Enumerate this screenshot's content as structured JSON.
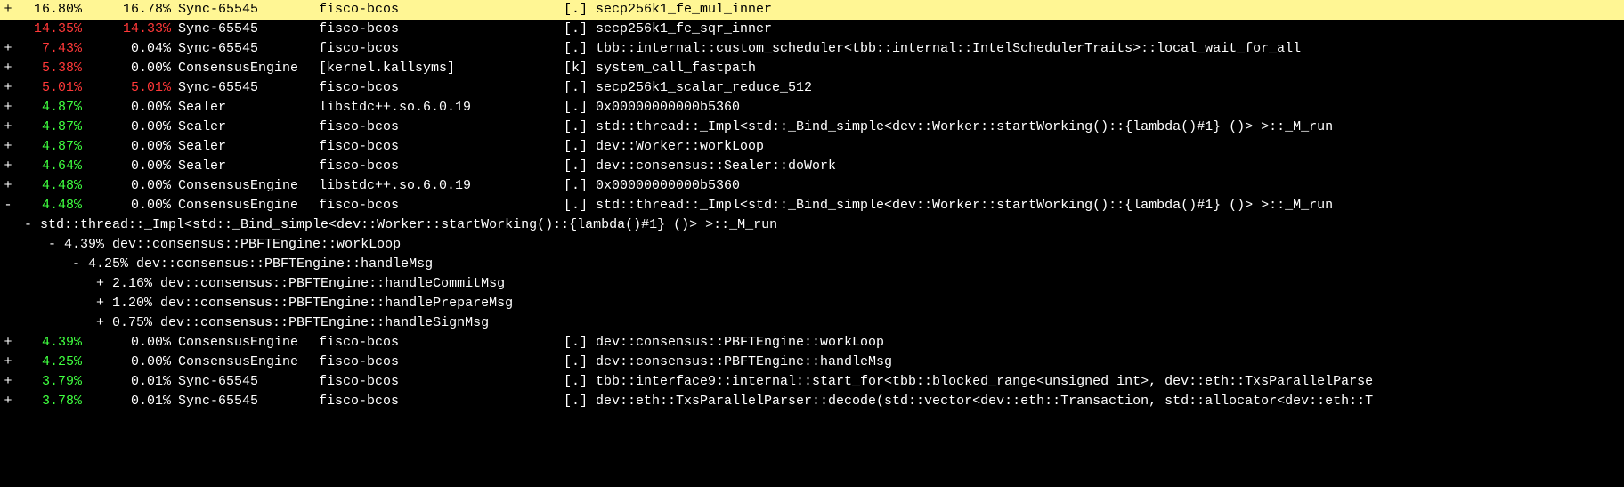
{
  "rows": [
    {
      "expander": "+",
      "overhead": "16.80%",
      "overheadColor": "white",
      "self": "16.78%",
      "selfColor": "white",
      "command": "Sync-65545",
      "object": "fisco-bcos",
      "marker": "[.]",
      "symbol": "secp256k1_fe_mul_inner",
      "highlighted": true
    },
    {
      "expander": "",
      "overhead": "14.35%",
      "overheadColor": "red",
      "self": "14.33%",
      "selfColor": "red",
      "command": "Sync-65545",
      "object": "fisco-bcos",
      "marker": "[.]",
      "symbol": "secp256k1_fe_sqr_inner"
    },
    {
      "expander": "+",
      "overhead": "7.43%",
      "overheadColor": "red",
      "self": "0.04%",
      "selfColor": "white",
      "command": "Sync-65545",
      "object": "fisco-bcos",
      "marker": "[.]",
      "symbol": "tbb::internal::custom_scheduler<tbb::internal::IntelSchedulerTraits>::local_wait_for_all"
    },
    {
      "expander": "+",
      "overhead": "5.38%",
      "overheadColor": "red",
      "self": "0.00%",
      "selfColor": "white",
      "command": "ConsensusEngine",
      "object": "[kernel.kallsyms]",
      "marker": "[k]",
      "symbol": "system_call_fastpath"
    },
    {
      "expander": "+",
      "overhead": "5.01%",
      "overheadColor": "red",
      "self": "5.01%",
      "selfColor": "red",
      "command": "Sync-65545",
      "object": "fisco-bcos",
      "marker": "[.]",
      "symbol": "secp256k1_scalar_reduce_512"
    },
    {
      "expander": "+",
      "overhead": "4.87%",
      "overheadColor": "green",
      "self": "0.00%",
      "selfColor": "white",
      "command": "Sealer",
      "object": "libstdc++.so.6.0.19",
      "marker": "[.]",
      "symbol": "0x00000000000b5360"
    },
    {
      "expander": "+",
      "overhead": "4.87%",
      "overheadColor": "green",
      "self": "0.00%",
      "selfColor": "white",
      "command": "Sealer",
      "object": "fisco-bcos",
      "marker": "[.]",
      "symbol": "std::thread::_Impl<std::_Bind_simple<dev::Worker::startWorking()::{lambda()#1} ()> >::_M_run"
    },
    {
      "expander": "+",
      "overhead": "4.87%",
      "overheadColor": "green",
      "self": "0.00%",
      "selfColor": "white",
      "command": "Sealer",
      "object": "fisco-bcos",
      "marker": "[.]",
      "symbol": "dev::Worker::workLoop"
    },
    {
      "expander": "+",
      "overhead": "4.64%",
      "overheadColor": "green",
      "self": "0.00%",
      "selfColor": "white",
      "command": "Sealer",
      "object": "fisco-bcos",
      "marker": "[.]",
      "symbol": "dev::consensus::Sealer::doWork"
    },
    {
      "expander": "+",
      "overhead": "4.48%",
      "overheadColor": "green",
      "self": "0.00%",
      "selfColor": "white",
      "command": "ConsensusEngine",
      "object": "libstdc++.so.6.0.19",
      "marker": "[.]",
      "symbol": "0x00000000000b5360"
    },
    {
      "expander": "-",
      "overhead": "4.48%",
      "overheadColor": "green",
      "self": "0.00%",
      "selfColor": "white",
      "command": "ConsensusEngine",
      "object": "fisco-bcos",
      "marker": "[.]",
      "symbol": "std::thread::_Impl<std::_Bind_simple<dev::Worker::startWorking()::{lambda()#1} ()> >::_M_run"
    }
  ],
  "tree": [
    {
      "indent": 3,
      "text": "- std::thread::_Impl<std::_Bind_simple<dev::Worker::startWorking()::{lambda()#1} ()> >::_M_run"
    },
    {
      "indent": 6,
      "text": "- 4.39% dev::consensus::PBFTEngine::workLoop"
    },
    {
      "indent": 9,
      "text": "- 4.25% dev::consensus::PBFTEngine::handleMsg"
    },
    {
      "indent": 12,
      "text": "+ 2.16% dev::consensus::PBFTEngine::handleCommitMsg"
    },
    {
      "indent": 12,
      "text": "+ 1.20% dev::consensus::PBFTEngine::handlePrepareMsg"
    },
    {
      "indent": 12,
      "text": "+ 0.75% dev::consensus::PBFTEngine::handleSignMsg"
    }
  ],
  "rows2": [
    {
      "expander": "+",
      "overhead": "4.39%",
      "overheadColor": "green",
      "self": "0.00%",
      "selfColor": "white",
      "command": "ConsensusEngine",
      "object": "fisco-bcos",
      "marker": "[.]",
      "symbol": "dev::consensus::PBFTEngine::workLoop"
    },
    {
      "expander": "+",
      "overhead": "4.25%",
      "overheadColor": "green",
      "self": "0.00%",
      "selfColor": "white",
      "command": "ConsensusEngine",
      "object": "fisco-bcos",
      "marker": "[.]",
      "symbol": "dev::consensus::PBFTEngine::handleMsg"
    },
    {
      "expander": "+",
      "overhead": "3.79%",
      "overheadColor": "green",
      "self": "0.01%",
      "selfColor": "white",
      "command": "Sync-65545",
      "object": "fisco-bcos",
      "marker": "[.]",
      "symbol": "tbb::interface9::internal::start_for<tbb::blocked_range<unsigned int>, dev::eth::TxsParallelParse"
    },
    {
      "expander": "+",
      "overhead": "3.78%",
      "overheadColor": "green",
      "self": "0.01%",
      "selfColor": "white",
      "command": "Sync-65545",
      "object": "fisco-bcos",
      "marker": "[.]",
      "symbol": "dev::eth::TxsParallelParser::decode(std::vector<dev::eth::Transaction, std::allocator<dev::eth::T"
    }
  ]
}
